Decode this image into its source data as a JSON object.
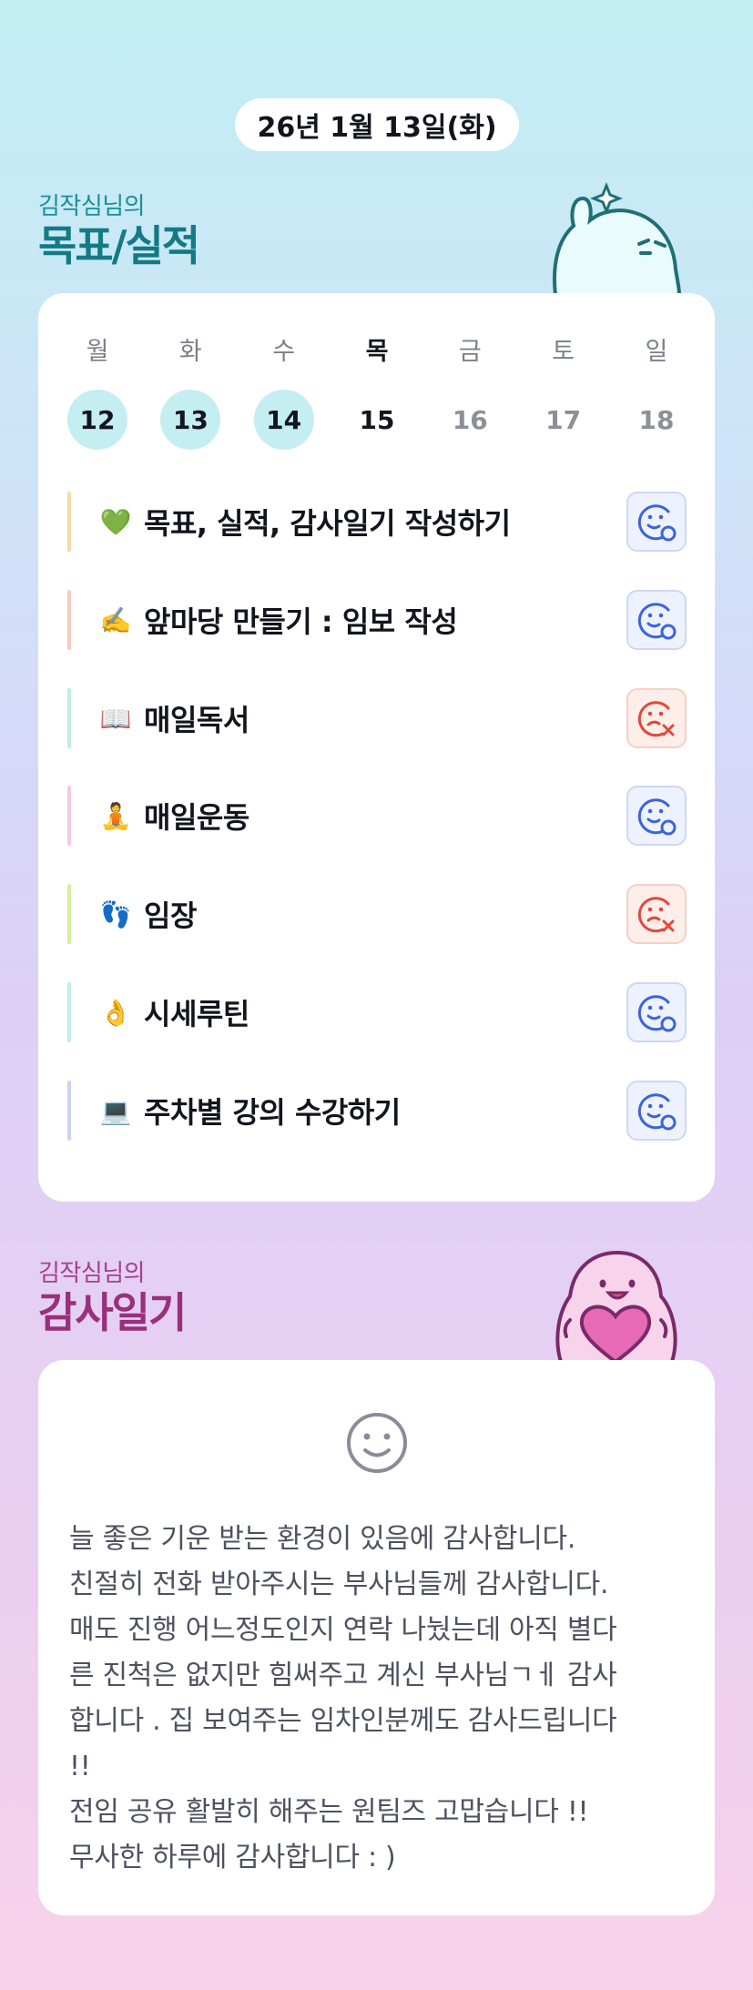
{
  "date": "26년 1월 13일(화)",
  "goals_section": {
    "subtitle": "김작심님의",
    "title": "목표/실적"
  },
  "week": [
    {
      "day": "월",
      "date": "12",
      "state": "done"
    },
    {
      "day": "화",
      "date": "13",
      "state": "done"
    },
    {
      "day": "수",
      "date": "14",
      "state": "done"
    },
    {
      "day": "목",
      "date": "15",
      "state": "today"
    },
    {
      "day": "금",
      "date": "16",
      "state": "future"
    },
    {
      "day": "토",
      "date": "17",
      "state": "future"
    },
    {
      "day": "일",
      "date": "18",
      "state": "future"
    }
  ],
  "goals": [
    {
      "emoji": "💚",
      "label": "목표, 실적, 감사일기 작성하기",
      "accent": "#f8d9a8",
      "status": "achieved",
      "status_icon": "smile-check-icon"
    },
    {
      "emoji": "✍️",
      "label": "앞마당 만들기 : 임보 작성",
      "accent": "#f8c9c3",
      "status": "achieved",
      "status_icon": "smile-check-icon"
    },
    {
      "emoji": "📖",
      "label": "매일독서",
      "accent": "#bfeede",
      "status": "missed",
      "status_icon": "sad-x-icon"
    },
    {
      "emoji": "🧘",
      "label": "매일운동",
      "accent": "#f7c8e6",
      "status": "achieved",
      "status_icon": "smile-check-icon"
    },
    {
      "emoji": "👣",
      "label": "임장",
      "accent": "#d4ef9c",
      "status": "missed",
      "status_icon": "sad-x-icon"
    },
    {
      "emoji": "👌",
      "label": "시세루틴",
      "accent": "#c2ecf1",
      "status": "achieved",
      "status_icon": "smile-check-icon"
    },
    {
      "emoji": "💻",
      "label": "주차별 강의 수강하기",
      "accent": "#cbd4f1",
      "status": "achieved",
      "status_icon": "smile-check-icon"
    }
  ],
  "diary_section": {
    "subtitle": "김작심님의",
    "title": "감사일기"
  },
  "diary": {
    "icon": "smiley-icon",
    "lines": [
      "늘 좋은 기운 받는 환경이 있음에 감사합니다.",
      "친절히 전화 받아주시는 부사님들께 감사합니다.",
      "매도 진행 어느정도인지 연락 나눴는데 아직 별다",
      "른 진척은 없지만 힘써주고 계신 부사님ㄱㅔ 감사",
      "합니다 . 집 보여주는 임차인분께도 감사드립니다",
      "!!",
      "전임 공유 활발히 해주는 원팀즈 고맙습니다 !!",
      "무사한 하루에 감사합니다 : )"
    ]
  },
  "colors": {
    "teal_title": "#137a86",
    "plum_title": "#9a2f7c",
    "done_day": "#c4eef1",
    "ok_icon": "#3a64e0",
    "bad_icon": "#e0493a"
  }
}
